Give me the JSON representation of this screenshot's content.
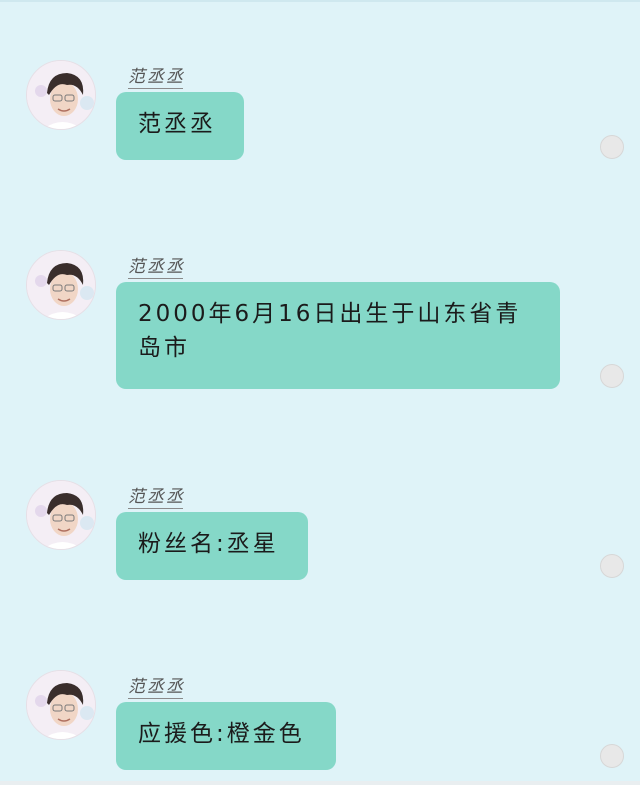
{
  "messages": [
    {
      "sender": "范丞丞",
      "text": "范丞丞"
    },
    {
      "sender": "范丞丞",
      "text": "2000年6月16日出生于山东省青岛市"
    },
    {
      "sender": "范丞丞",
      "text": "粉丝名:丞星"
    },
    {
      "sender": "范丞丞",
      "text": "应援色:橙金色"
    }
  ],
  "colors": {
    "background": "#dff3f8",
    "bubble": "#85d8c8",
    "select_dot": "#e8e8e8"
  },
  "icons": {
    "avatar": "profile-photo",
    "select": "selection-circle-icon"
  }
}
